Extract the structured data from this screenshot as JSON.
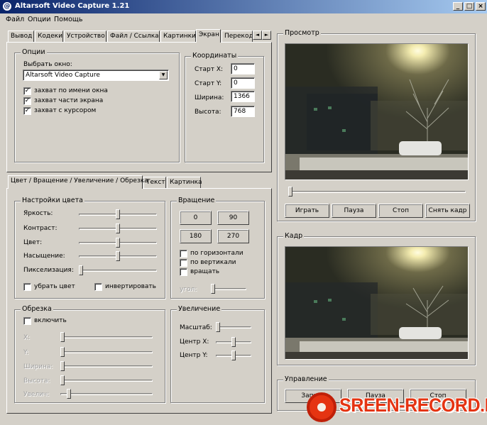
{
  "window": {
    "title": "Altarsoft Video Capture 1.21",
    "icon": "app-logo-icon",
    "controls": {
      "minimize": "_",
      "maximize": "□",
      "close": "×"
    }
  },
  "menu": [
    "Файл",
    "Опции",
    "Помощь"
  ],
  "top_tabs": [
    "Вывод",
    "Кодеки",
    "Устройство",
    "Файл / Ссылка",
    "Картинки",
    "Экран",
    "Перекодк"
  ],
  "top_tabs_active": "Экран",
  "tab_scroll": {
    "left": "◄",
    "right": "►"
  },
  "options": {
    "title": "Опции",
    "select_window_label": "Выбрать окно:",
    "select_window_value": "Altarsoft Video Capture",
    "dropdown_arrow": "▼",
    "checks": [
      {
        "label": "захват по имени окна",
        "checked": true
      },
      {
        "label": "захват части экрана",
        "checked": true
      },
      {
        "label": "захват с курсором",
        "checked": true
      }
    ],
    "check_mark": "✓"
  },
  "coords": {
    "title": "Координаты",
    "fields": [
      {
        "label": "Старт X:",
        "value": "0"
      },
      {
        "label": "Старт Y:",
        "value": "0"
      },
      {
        "label": "Ширина:",
        "value": "1366"
      },
      {
        "label": "Высота:",
        "value": "768"
      }
    ]
  },
  "lower_tabs": [
    "Цвет / Вращение / Увеличение / Обрезка",
    "Текст",
    "Картинка"
  ],
  "lower_tabs_active": "Цвет / Вращение / Увеличение / Обрезка",
  "color": {
    "title": "Настройки цвета",
    "sliders": [
      {
        "label": "Яркость:",
        "value": 0.5
      },
      {
        "label": "Контраст:",
        "value": 0.5
      },
      {
        "label": "Цвет:",
        "value": 0.5
      },
      {
        "label": "Насыщение:",
        "value": 0.5
      },
      {
        "label": "Пикселизация:",
        "value": 0.0
      }
    ],
    "remove_color": "убрать цвет",
    "invert": "инвертировать"
  },
  "rotation": {
    "title": "Вращение",
    "buttons": [
      "0",
      "90",
      "180",
      "270"
    ],
    "checks": [
      "по горизонтали",
      "по вертикали",
      "вращать"
    ],
    "angle_label": "угол:",
    "angle_value": 0.0
  },
  "crop": {
    "title": "Обрезка",
    "enable": "включить",
    "sliders": [
      {
        "label": "X:",
        "value": 0.0
      },
      {
        "label": "Y:",
        "value": 0.0
      },
      {
        "label": "Ширина:",
        "value": 0.0
      },
      {
        "label": "Высота:",
        "value": 0.0
      },
      {
        "label": "Увелич:",
        "value": 0.07
      }
    ]
  },
  "zoom": {
    "title": "Увеличение",
    "sliders": [
      {
        "label": "Масштаб:",
        "value": 0.0
      },
      {
        "label": "Центр X:",
        "value": 0.5
      },
      {
        "label": "Центр Y:",
        "value": 0.5
      }
    ]
  },
  "preview": {
    "title": "Просмотр",
    "position": 0.0,
    "buttons": [
      "Играть",
      "Пауза",
      "Стоп",
      "Снять кадр"
    ]
  },
  "frame": {
    "title": "Кадр"
  },
  "control": {
    "title": "Управление",
    "buttons": [
      "Запись",
      "Пауза",
      "Стоп"
    ]
  },
  "watermark": {
    "text": "SREEN-RECORD.RU"
  }
}
